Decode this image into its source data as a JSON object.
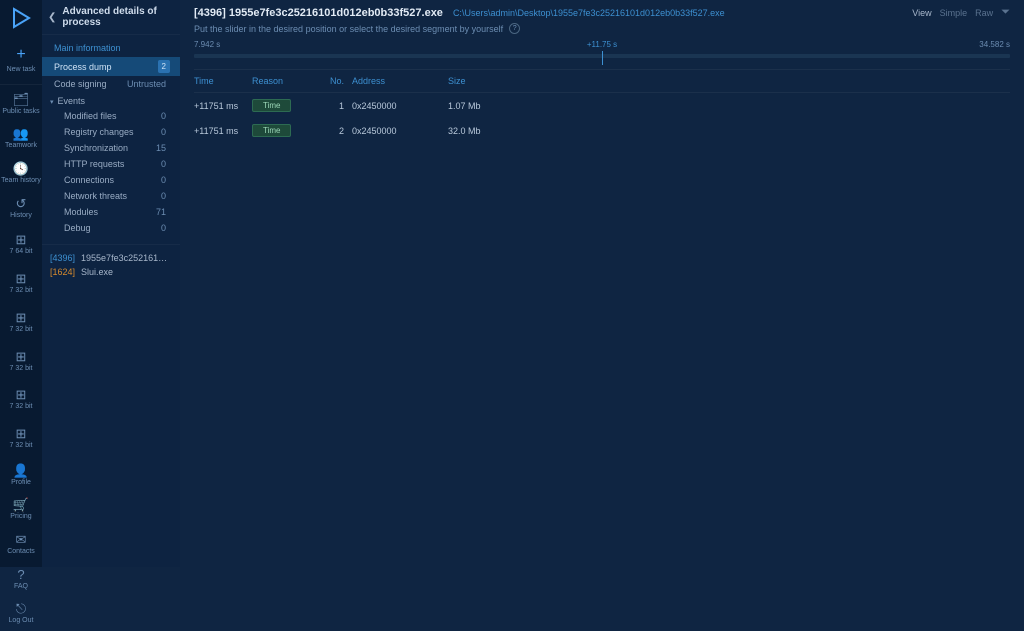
{
  "rail": {
    "new_label": "New task",
    "items": [
      {
        "icon": "🗂",
        "label": "Public tasks"
      },
      {
        "icon": "👥",
        "label": "Teamwork"
      },
      {
        "icon": "🕓",
        "label": "Team history"
      },
      {
        "icon": "↺",
        "label": "History"
      }
    ],
    "bits": [
      {
        "label": "7 64 bit"
      },
      {
        "label": "7 32 bit"
      },
      {
        "label": "7 32 bit"
      },
      {
        "label": "7 32 bit"
      },
      {
        "label": "7 32 bit"
      },
      {
        "label": "7 32 bit"
      }
    ],
    "bottom": [
      {
        "icon": "👤",
        "label": "Profile"
      },
      {
        "icon": "🛒",
        "label": "Pricing"
      },
      {
        "icon": "✉",
        "label": "Contacts"
      },
      {
        "icon": "?",
        "label": "FAQ"
      },
      {
        "icon": "⎋",
        "label": "Log Out"
      }
    ]
  },
  "sidebar": {
    "title": "Advanced details of process",
    "main_info": "Main information",
    "process_dump": {
      "label": "Process dump",
      "count": "2"
    },
    "code_signing": {
      "label": "Code signing",
      "value": "Untrusted"
    },
    "events_label": "Events",
    "events": [
      {
        "label": "Modified files",
        "count": "0"
      },
      {
        "label": "Registry changes",
        "count": "0"
      },
      {
        "label": "Synchronization",
        "count": "15"
      },
      {
        "label": "HTTP requests",
        "count": "0"
      },
      {
        "label": "Connections",
        "count": "0"
      },
      {
        "label": "Network threats",
        "count": "0"
      },
      {
        "label": "Modules",
        "count": "71"
      },
      {
        "label": "Debug",
        "count": "0"
      }
    ],
    "procs": [
      {
        "pid": "[4396]",
        "name": "1955e7fe3c25216101d012..."
      },
      {
        "pid": "[1624]",
        "name": "Slui.exe"
      }
    ]
  },
  "main": {
    "title": "[4396] 1955e7fe3c25216101d012eb0b33f527.exe",
    "path": "C:\\Users\\admin\\Desktop\\1955e7fe3c25216101d012eb0b33f527.exe",
    "view_label": "View",
    "simple": "Simple",
    "raw": "Raw",
    "instructions": "Put the slider in the desired position or select the desired segment by yourself",
    "timeline": {
      "start": "7.942 s",
      "mid": "+11.75 s",
      "end": "34.582 s"
    },
    "columns": {
      "time": "Time",
      "reason": "Reason",
      "no": "No.",
      "address": "Address",
      "size": "Size"
    },
    "rows": [
      {
        "time": "+11751 ms",
        "reason": "Time",
        "no": "1",
        "address": "0x2450000",
        "size": "1.07 Mb"
      },
      {
        "time": "+11751 ms",
        "reason": "Time",
        "no": "2",
        "address": "0x2450000",
        "size": "32.0 Mb"
      }
    ]
  }
}
